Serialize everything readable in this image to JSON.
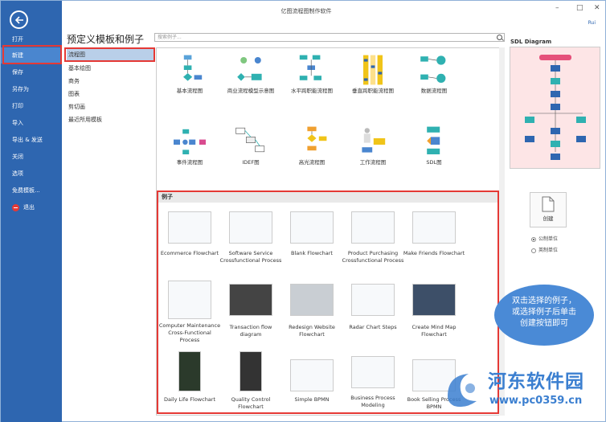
{
  "window": {
    "title": "亿图流程图制作软件",
    "user": "Rui"
  },
  "sidebar": {
    "items": [
      {
        "label": "打开"
      },
      {
        "label": "新建"
      },
      {
        "label": "保存"
      },
      {
        "label": "另存为"
      },
      {
        "label": "打印"
      },
      {
        "label": "导入"
      },
      {
        "label": "导出 & 发送"
      },
      {
        "label": "关闭"
      },
      {
        "label": "选项"
      },
      {
        "label": "免费模板..."
      },
      {
        "label": "退出"
      }
    ]
  },
  "header": {
    "title": "预定义模板和例子",
    "search_placeholder": "搜索例子..."
  },
  "categories": [
    {
      "label": "流程图"
    },
    {
      "label": "基本绘图"
    },
    {
      "label": "商务"
    },
    {
      "label": "图表"
    },
    {
      "label": "剪切画"
    },
    {
      "label": "最近所用模板"
    }
  ],
  "templates": [
    {
      "label": "基本流程图"
    },
    {
      "label": "商业流程模型示意图"
    },
    {
      "label": "水平跨职能流程图"
    },
    {
      "label": "垂直跨职能流程图"
    },
    {
      "label": "数据流程图"
    },
    {
      "label": "事件流程图"
    },
    {
      "label": "IDEF图"
    },
    {
      "label": "高光流程图"
    },
    {
      "label": "工作流程图"
    },
    {
      "label": "SDL图"
    }
  ],
  "examples_section": {
    "title": "例子"
  },
  "examples": [
    {
      "label": "Ecommerce Flowchart"
    },
    {
      "label": "Software Service Crossfunctional Process"
    },
    {
      "label": "Blank Flowchart"
    },
    {
      "label": "Product Purchasing Crossfunctional Process"
    },
    {
      "label": "Make Friends Flowchart"
    },
    {
      "label": "Computer Maintenance Cross-Functional Process"
    },
    {
      "label": "Transaction flow diagram"
    },
    {
      "label": "Redesign Website Flowchart"
    },
    {
      "label": "Radar Chart Steps"
    },
    {
      "label": "Create Mind Map Flowchart"
    },
    {
      "label": "Daily Life Flowchart"
    },
    {
      "label": "Quality Control Flowchart"
    },
    {
      "label": "Simple BPMN"
    },
    {
      "label": "Business Process Modeling"
    },
    {
      "label": "Book Selling Process BPMN"
    }
  ],
  "right_panel": {
    "title": "SDL Diagram",
    "create_label": "创建",
    "units": [
      {
        "label": "公制单位",
        "selected": true
      },
      {
        "label": "英制单位",
        "selected": false
      }
    ]
  },
  "callout": {
    "line1": "双击选择的例子，",
    "line2": "或选择例子后单击",
    "line3": "创建按钮即可"
  },
  "watermark": {
    "name": "河东软件园",
    "url": "www.pc0359.cn"
  },
  "colors": {
    "sidebar": "#2e66b0",
    "active_item": "#4a86cf",
    "highlight": "#e53935",
    "callout": "#4a8ad6"
  }
}
